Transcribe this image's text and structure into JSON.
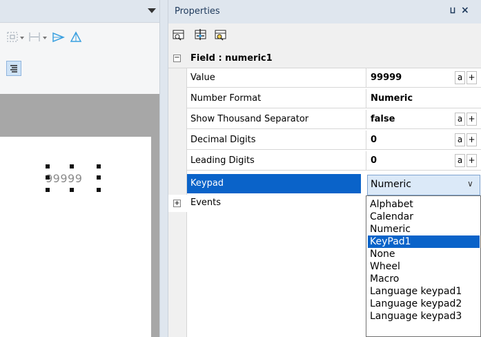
{
  "designer": {
    "field_value": "99999"
  },
  "properties": {
    "title": "Properties",
    "pin_glyph": "⨿",
    "close_glyph": "×",
    "group": {
      "toggle": "−",
      "title": "Field : numeric1"
    },
    "rows": [
      {
        "name": "Value",
        "value": "99999",
        "btn_a": "a",
        "btn_plus": "+"
      },
      {
        "name": "Number Format",
        "value": "Numeric"
      },
      {
        "name": "Show Thousand Separator",
        "value": "false",
        "btn_a": "a",
        "btn_plus": "+"
      },
      {
        "name": "Decimal Digits",
        "value": "0",
        "btn_a": "a",
        "btn_plus": "+"
      },
      {
        "name": "Leading Digits",
        "value": "0",
        "btn_a": "a",
        "btn_plus": "+"
      }
    ],
    "keypad": {
      "name": "Keypad",
      "selected": "Numeric",
      "chevron": "∨",
      "options": [
        "Alphabet",
        "Calendar",
        "Numeric",
        "KeyPad1",
        "None",
        "Wheel",
        "Macro",
        "Language keypad1",
        "Language keypad2",
        "Language keypad3"
      ],
      "highlighted_index": 3
    },
    "events": {
      "toggle": "+",
      "label": "Events"
    }
  },
  "colors": {
    "selection": "#0a63c9",
    "header": "#dfe6ee"
  }
}
